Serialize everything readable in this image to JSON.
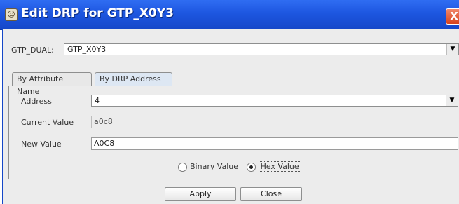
{
  "window": {
    "title": "Edit DRP for GTP_X0Y3",
    "close_glyph": "X"
  },
  "gtp_dual": {
    "label": "GTP_DUAL:",
    "value": "GTP_X0Y3"
  },
  "tabs": [
    {
      "label": "By Attribute Name",
      "active": false
    },
    {
      "label": "By DRP Address",
      "active": true
    }
  ],
  "form": {
    "address_label": "Address",
    "address_value": "4",
    "current_label": "Current Value",
    "current_value": "a0c8",
    "new_label": "New Value",
    "new_value": "A0C8"
  },
  "radios": {
    "binary_label": "Binary Value",
    "hex_label": "Hex Value",
    "selected": "hex"
  },
  "buttons": {
    "apply": "Apply",
    "close": "Close"
  },
  "icons": {
    "title": "app-icon",
    "combo_arrow": "chevron-down-icon"
  },
  "colors": {
    "titlebar": "#1d56e0",
    "body": "#ececec",
    "close_button": "#d8421c"
  }
}
